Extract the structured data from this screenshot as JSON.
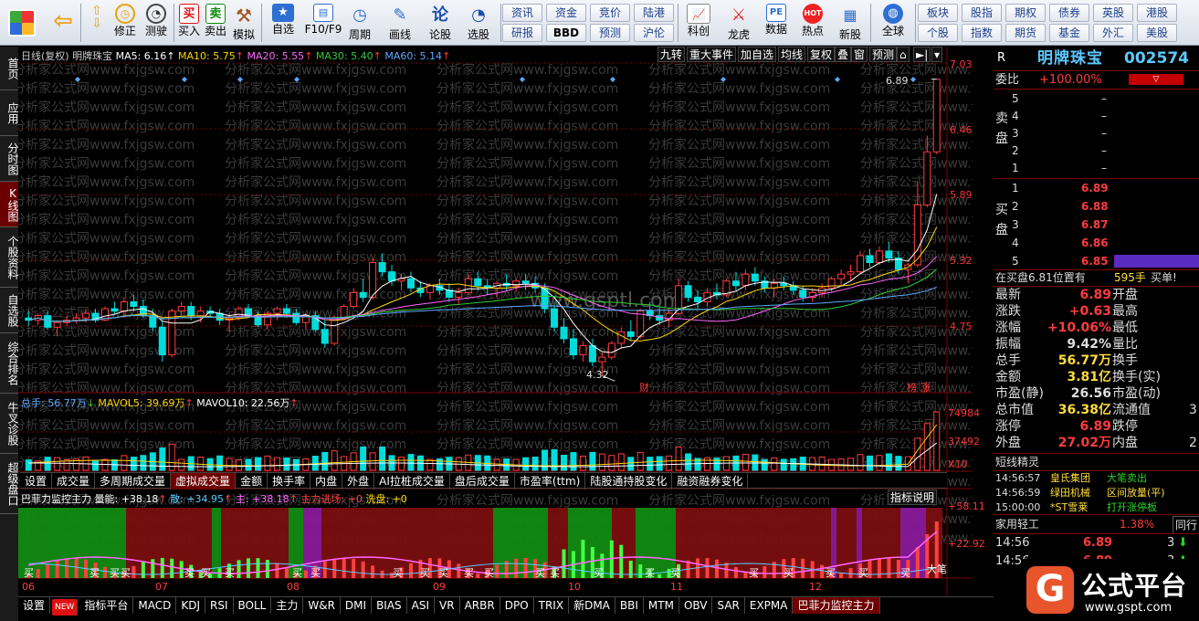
{
  "toolbar": {
    "buttons": [
      {
        "id": "menu",
        "label": ""
      },
      {
        "id": "back",
        "label": ""
      },
      {
        "id": "fix",
        "label": "修正"
      },
      {
        "id": "test",
        "label": "测试"
      },
      {
        "id": "timer",
        "label": "测驶"
      },
      {
        "id": "buy",
        "label": "买入",
        "icon": "买"
      },
      {
        "id": "sell",
        "label": "卖出",
        "icon": "卖"
      },
      {
        "id": "sim",
        "label": "模拟"
      },
      {
        "id": "watch",
        "label": "自选"
      },
      {
        "id": "f10",
        "label": "F10/F9"
      },
      {
        "id": "period",
        "label": "周期"
      },
      {
        "id": "draw",
        "label": "画线"
      },
      {
        "id": "stockbar",
        "label": "论股",
        "icon": "论"
      },
      {
        "id": "select",
        "label": "选股"
      }
    ],
    "grid1": [
      "资讯",
      "资金",
      "竞价",
      "陆港",
      "研报",
      "BBD",
      "预测",
      "沪伦"
    ],
    "icons2": [
      {
        "id": "kechuang",
        "label": "科创"
      },
      {
        "id": "longhu",
        "label": "龙虎"
      },
      {
        "id": "data",
        "label": "数据",
        "icon": "PE"
      },
      {
        "id": "hot",
        "label": "热点",
        "icon": "HOT"
      },
      {
        "id": "newstock",
        "label": "新股"
      },
      {
        "id": "global",
        "label": "全球"
      }
    ],
    "grid2": [
      "板块",
      "股指",
      "期权",
      "债券",
      "英股",
      "港股",
      "个股",
      "指数",
      "期货",
      "基金",
      "外汇",
      "美股"
    ]
  },
  "lefttabs": [
    "首页",
    "应用",
    "分时图",
    "K线图",
    "个股资料",
    "自选股",
    "综合排名",
    "牛叉诊股",
    "超级盘口"
  ],
  "chart": {
    "header": {
      "title": "日线(复权)",
      "stock": "明牌珠宝",
      "ma": [
        {
          "label": "MA5: 6.16",
          "color": "#ffffff"
        },
        {
          "label": "MA10: 5.75",
          "color": "#ffd700"
        },
        {
          "label": "MA20: 5.55",
          "color": "#ff66ff"
        },
        {
          "label": "MA30: 5.40",
          "color": "#33cc33"
        },
        {
          "label": "MA60: 5.14",
          "color": "#5aa8ff"
        }
      ]
    },
    "topbuttons": [
      "九转",
      "重大事件",
      "加自选",
      "均线",
      "复权",
      "叠",
      "窗",
      "预测"
    ],
    "price_axis": [
      "7.03",
      "6.46",
      "5.89",
      "5.32",
      "4.75"
    ],
    "high_label": "6.89",
    "low_label": "4.32",
    "tags": [
      "财",
      "榜",
      "涨"
    ],
    "watermark": "分析家公式网www.fxjgsw.com",
    "center_watermark": "www.gsptl.com",
    "vol": {
      "header": "总手: 56.77万",
      "mavol5": "MAVOL5: 39.69万",
      "mavol10": "MAVOL10: 22.56万",
      "axis": [
        "74984",
        "37492"
      ],
      "unit": "X10"
    },
    "midtabs": [
      "设置",
      "成交量",
      "多周期成交量",
      "虚拟成交量",
      "金额",
      "换手率",
      "内盘",
      "外盘",
      "AI拉桩成交量",
      "盘后成交量",
      "市盈率(ttm)",
      "陆股通持股变化",
      "融资融券变化"
    ],
    "ind": {
      "name": "巴菲力监控主力",
      "liang": "量能: +38.18",
      "san": "散: +34.95",
      "zhu": "主: +38.18",
      "jinchang": "主力进场: +0",
      "xipan": "洗盘: +0",
      "explain": "指标说明",
      "axis": [
        "+58.11",
        "+22.92"
      ],
      "buy": "买",
      "bigbuy": "大笔"
    },
    "months": [
      "06",
      "07",
      "08",
      "09",
      "10",
      "11",
      "12"
    ],
    "bottomtabs": [
      "设置",
      "NEW",
      "指标平台",
      "MACD",
      "KDJ",
      "RSI",
      "BOLL",
      "主力",
      "W&R",
      "DMI",
      "BIAS",
      "ASI",
      "VR",
      "ARBR",
      "DPO",
      "TRIX",
      "新DMA",
      "BBI",
      "MTM",
      "OBV",
      "SAR",
      "EXPMA",
      "巴菲力监控主力"
    ]
  },
  "rightpanel": {
    "r": "R",
    "name": "明牌珠宝",
    "code": "002574",
    "weibi_label": "委比",
    "weibi": "+100.00%",
    "sell_label": [
      "卖",
      "盘"
    ],
    "buy_label": [
      "买",
      "盘"
    ],
    "sell": [
      {
        "lv": "5",
        "p": "–"
      },
      {
        "lv": "4",
        "p": "–"
      },
      {
        "lv": "3",
        "p": "–"
      },
      {
        "lv": "2",
        "p": "–"
      },
      {
        "lv": "1",
        "p": "–"
      }
    ],
    "buy": [
      {
        "lv": "1",
        "p": "6.89"
      },
      {
        "lv": "2",
        "p": "6.88"
      },
      {
        "lv": "3",
        "p": "6.87"
      },
      {
        "lv": "4",
        "p": "6.86"
      },
      {
        "lv": "5",
        "p": "6.85"
      }
    ],
    "bidinfo": {
      "pos": "在买盘6.81位置有",
      "vol": "595手",
      "note": "买单!"
    },
    "quotes": [
      {
        "k": "最新",
        "v": "6.89",
        "c": "red",
        "k2": "开盘",
        "v2": ""
      },
      {
        "k": "涨跌",
        "v": "+0.63",
        "c": "red",
        "k2": "最高",
        "v2": ""
      },
      {
        "k": "涨幅",
        "v": "+10.06%",
        "c": "red",
        "k2": "最低",
        "v2": ""
      },
      {
        "k": "振幅",
        "v": "9.42%",
        "c": "wht",
        "k2": "量比",
        "v2": ""
      },
      {
        "k": "总手",
        "v": "56.77万",
        "c": "yel",
        "k2": "换手",
        "v2": ""
      },
      {
        "k": "金额",
        "v": "3.81亿",
        "c": "yel",
        "k2": "换手(实)",
        "v2": ""
      },
      {
        "k": "市盈(静)",
        "v": "26.56",
        "c": "wht",
        "k2": "市盈(动)",
        "v2": ""
      },
      {
        "k": "总市值",
        "v": "36.38亿",
        "c": "yel",
        "k2": "流通值",
        "v2": "3"
      },
      {
        "k": "涨停",
        "v": "6.89",
        "c": "red",
        "k2": "跌停",
        "v2": ""
      },
      {
        "k": "外盘",
        "v": "27.02万",
        "c": "red",
        "k2": "内盘",
        "v2": "2"
      }
    ],
    "jingling_title": "短线精灵",
    "jingling": [
      {
        "t": "14:56:57",
        "s": "皇氏集团",
        "a": "大笔卖出",
        "c": "grn"
      },
      {
        "t": "14:56:59",
        "s": "绿田机械",
        "a": "区间放量(平)",
        "c": "yel"
      },
      {
        "t": "15:00:00",
        "s": "*ST雪莱",
        "a": "打开涨停板",
        "c": "grn"
      }
    ],
    "industry": {
      "name": "家用轻工",
      "pct": "1.38%",
      "btn": "同行"
    },
    "ticks": [
      {
        "t": "14:56",
        "p": "6.89",
        "v": "3"
      },
      {
        "t": "14:56",
        "p": "6.89",
        "v": "3"
      }
    ]
  },
  "logo": {
    "text": "公式平台",
    "url": "www.gspt.com"
  },
  "colors": {
    "up": "#ff3c3c",
    "down": "#00dcdc",
    "ma5": "#ffffff",
    "ma10": "#ffd700",
    "ma20": "#ff66ff",
    "ma30": "#33cc33",
    "ma60": "#5aa8ff"
  },
  "chart_data": {
    "type": "candlestick",
    "series_name": "明牌珠宝",
    "ylim": [
      4.18,
      7.03
    ],
    "x_months": [
      "06",
      "07",
      "08",
      "09",
      "10",
      "11",
      "12"
    ],
    "ohlc": [
      [
        4.82,
        4.88,
        4.75,
        4.8
      ],
      [
        4.8,
        4.86,
        4.76,
        4.84
      ],
      [
        4.84,
        4.88,
        4.72,
        4.74
      ],
      [
        4.74,
        4.8,
        4.66,
        4.78
      ],
      [
        4.78,
        4.84,
        4.75,
        4.8
      ],
      [
        4.8,
        4.86,
        4.77,
        4.82
      ],
      [
        4.82,
        4.9,
        4.78,
        4.86
      ],
      [
        4.86,
        4.9,
        4.78,
        4.8
      ],
      [
        4.8,
        4.92,
        4.79,
        4.9
      ],
      [
        4.9,
        4.96,
        4.85,
        4.88
      ],
      [
        4.88,
        5.0,
        4.82,
        4.96
      ],
      [
        4.96,
        5.02,
        4.88,
        4.92
      ],
      [
        4.92,
        4.98,
        4.82,
        4.84
      ],
      [
        4.84,
        4.9,
        4.7,
        4.74
      ],
      [
        4.74,
        4.8,
        4.44,
        4.5
      ],
      [
        4.5,
        4.9,
        4.48,
        4.88
      ],
      [
        4.88,
        4.96,
        4.84,
        4.92
      ],
      [
        4.92,
        4.96,
        4.8,
        4.84
      ],
      [
        4.84,
        4.92,
        4.78,
        4.88
      ],
      [
        4.88,
        4.92,
        4.82,
        4.86
      ],
      [
        4.86,
        4.9,
        4.76,
        4.8
      ],
      [
        4.8,
        4.86,
        4.7,
        4.82
      ],
      [
        4.82,
        4.92,
        4.8,
        4.9
      ],
      [
        4.9,
        4.94,
        4.82,
        4.84
      ],
      [
        4.84,
        4.88,
        4.74,
        4.76
      ],
      [
        4.76,
        4.88,
        4.72,
        4.86
      ],
      [
        4.86,
        4.92,
        4.8,
        4.9
      ],
      [
        4.9,
        4.94,
        4.84,
        4.86
      ],
      [
        4.86,
        4.9,
        4.76,
        4.78
      ],
      [
        4.78,
        4.86,
        4.72,
        4.84
      ],
      [
        4.84,
        4.88,
        4.7,
        4.72
      ],
      [
        4.72,
        4.8,
        4.56,
        4.6
      ],
      [
        4.6,
        4.84,
        4.58,
        4.82
      ],
      [
        4.82,
        4.94,
        4.8,
        4.92
      ],
      [
        4.92,
        5.08,
        4.9,
        5.04
      ],
      [
        5.04,
        5.16,
        4.96,
        5.0
      ],
      [
        5.0,
        5.34,
        4.98,
        5.3
      ],
      [
        5.3,
        5.38,
        5.18,
        5.22
      ],
      [
        5.22,
        5.28,
        5.1,
        5.14
      ],
      [
        5.14,
        5.2,
        5.06,
        5.16
      ],
      [
        5.16,
        5.22,
        5.04,
        5.08
      ],
      [
        5.08,
        5.14,
        5.0,
        5.04
      ],
      [
        5.04,
        5.12,
        4.98,
        5.1
      ],
      [
        5.1,
        5.16,
        5.02,
        5.06
      ],
      [
        5.06,
        5.12,
        4.96,
        5.0
      ],
      [
        5.0,
        5.08,
        4.94,
        5.04
      ],
      [
        5.04,
        5.2,
        5.02,
        5.16
      ],
      [
        5.16,
        5.22,
        5.06,
        5.1
      ],
      [
        5.1,
        5.16,
        5.02,
        5.08
      ],
      [
        5.08,
        5.14,
        5.0,
        5.12
      ],
      [
        5.12,
        5.2,
        5.06,
        5.1
      ],
      [
        5.1,
        5.16,
        5.04,
        5.14
      ],
      [
        5.14,
        5.2,
        5.06,
        5.12
      ],
      [
        5.12,
        5.18,
        5.04,
        5.08
      ],
      [
        5.08,
        5.12,
        4.86,
        4.9
      ],
      [
        4.9,
        4.96,
        4.7,
        4.74
      ],
      [
        4.74,
        4.82,
        4.6,
        4.64
      ],
      [
        4.64,
        4.72,
        4.46,
        4.5
      ],
      [
        4.5,
        4.62,
        4.44,
        4.58
      ],
      [
        4.58,
        4.64,
        4.4,
        4.44
      ],
      [
        4.44,
        4.52,
        4.32,
        4.48
      ],
      [
        4.48,
        4.62,
        4.46,
        4.6
      ],
      [
        4.6,
        4.74,
        4.56,
        4.7
      ],
      [
        4.7,
        4.8,
        4.62,
        4.66
      ],
      [
        4.66,
        4.9,
        4.64,
        4.88
      ],
      [
        4.88,
        4.96,
        4.8,
        4.84
      ],
      [
        4.84,
        4.92,
        4.76,
        4.8
      ],
      [
        4.8,
        4.9,
        4.74,
        4.86
      ],
      [
        4.86,
        5.16,
        4.84,
        5.1
      ],
      [
        5.1,
        5.14,
        4.96,
        5.0
      ],
      [
        5.0,
        5.06,
        4.9,
        4.96
      ],
      [
        4.96,
        5.08,
        4.92,
        5.04
      ],
      [
        5.04,
        5.12,
        4.98,
        5.02
      ],
      [
        5.02,
        5.16,
        5.0,
        5.14
      ],
      [
        5.14,
        5.22,
        5.06,
        5.1
      ],
      [
        5.1,
        5.24,
        5.06,
        5.2
      ],
      [
        5.2,
        5.26,
        5.1,
        5.14
      ],
      [
        5.14,
        5.18,
        5.04,
        5.08
      ],
      [
        5.08,
        5.16,
        5.0,
        5.12
      ],
      [
        5.12,
        5.18,
        5.06,
        5.1
      ],
      [
        5.1,
        5.14,
        5.02,
        5.06
      ],
      [
        5.06,
        5.1,
        4.96,
        5.0
      ],
      [
        5.0,
        5.08,
        4.96,
        5.04
      ],
      [
        5.04,
        5.12,
        5.0,
        5.08
      ],
      [
        5.08,
        5.18,
        5.04,
        5.16
      ],
      [
        5.16,
        5.24,
        5.1,
        5.2
      ],
      [
        5.2,
        5.28,
        5.14,
        5.22
      ],
      [
        5.22,
        5.4,
        5.2,
        5.36
      ],
      [
        5.36,
        5.42,
        5.26,
        5.3
      ],
      [
        5.3,
        5.44,
        5.28,
        5.4
      ],
      [
        5.4,
        5.48,
        5.3,
        5.34
      ],
      [
        5.34,
        5.4,
        5.2,
        5.24
      ],
      [
        5.24,
        5.3,
        5.12,
        5.28
      ],
      [
        5.28,
        6.0,
        5.26,
        5.8
      ],
      [
        5.8,
        6.4,
        5.78,
        6.26
      ],
      [
        6.26,
        6.89,
        6.24,
        6.89
      ]
    ],
    "volume_scale": [
      74984,
      37492
    ],
    "annotations": {
      "high": 6.89,
      "low": 4.32
    }
  }
}
